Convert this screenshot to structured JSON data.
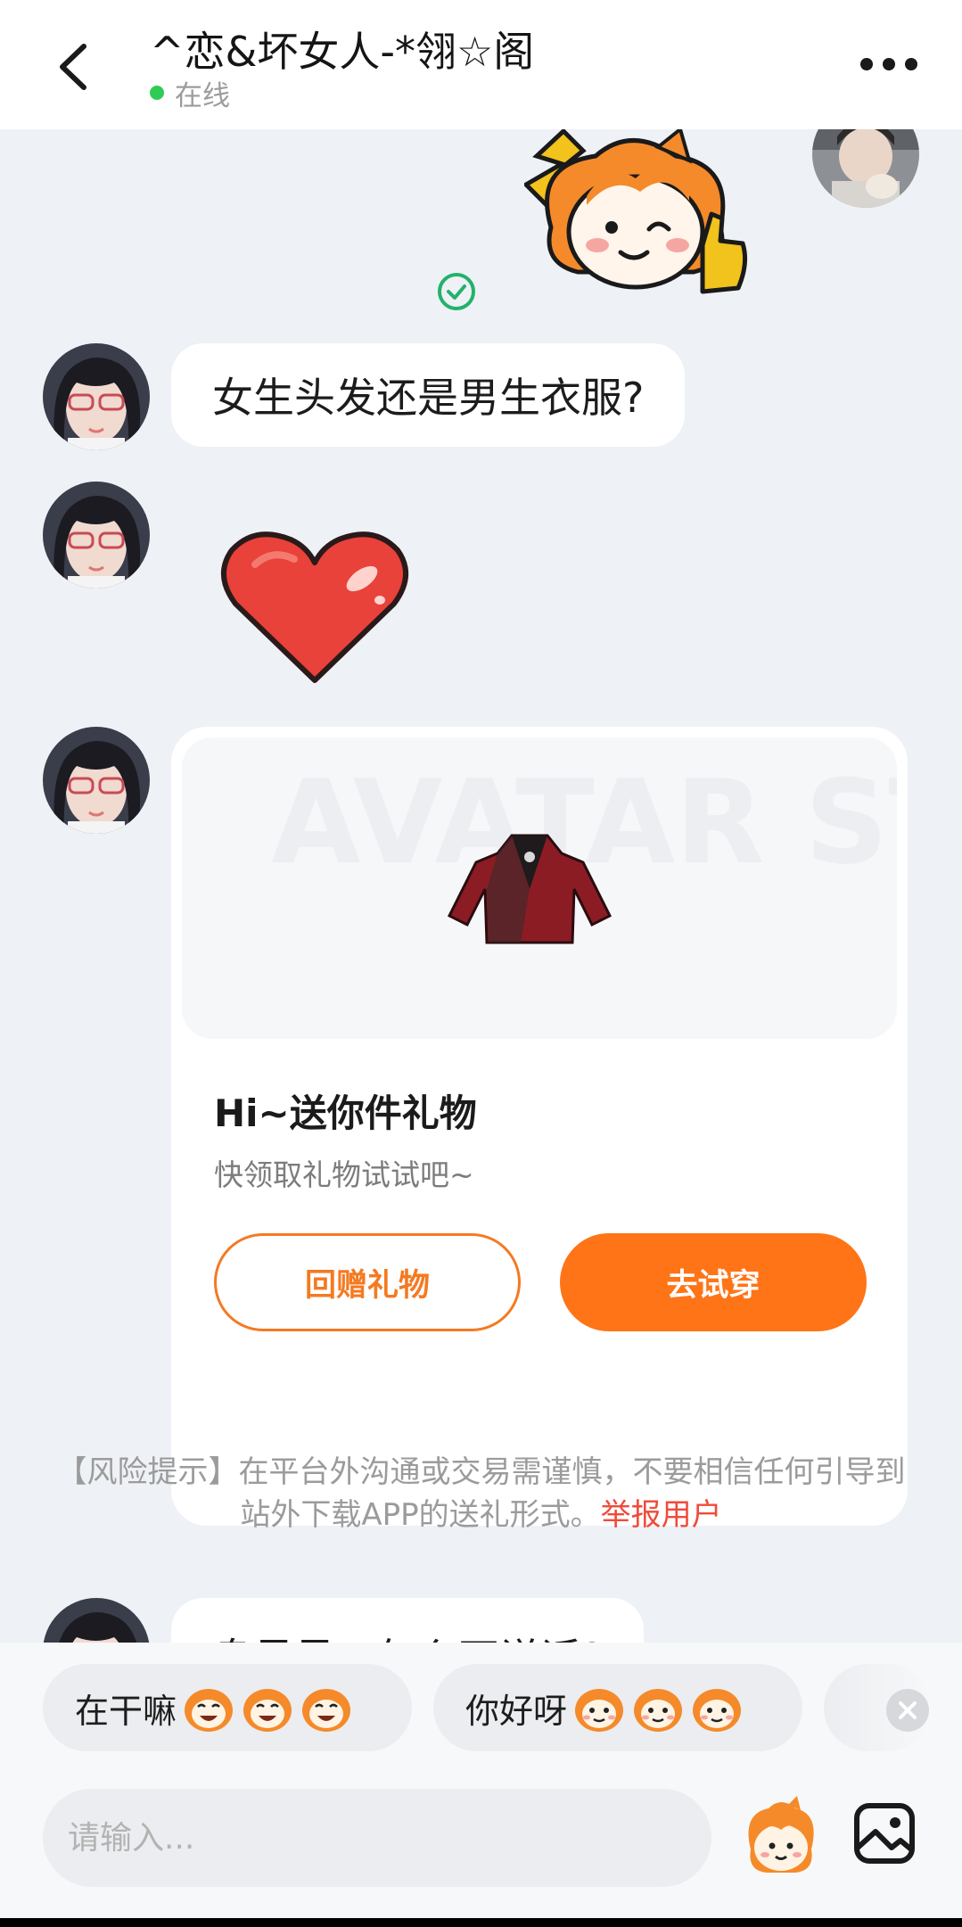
{
  "header": {
    "title": "^恋&坏女人-*翎☆阁",
    "status": "在线",
    "colors": {
      "online": "#2ecc55"
    }
  },
  "messages": [
    {
      "from": "me",
      "type": "sticker",
      "sticker": "orange-mascot-thumbs-up"
    },
    {
      "from": "other",
      "type": "text",
      "text": "女生头发还是男生衣服?"
    },
    {
      "from": "other",
      "type": "sticker",
      "sticker": "red-heart"
    },
    {
      "from": "other",
      "type": "gift-card",
      "title": "Hi~送你件礼物",
      "subtitle": "快领取礼物试试吧~",
      "image_watermark": "AVATAR STORE",
      "return_label": "回赠礼物",
      "try_label": "去试穿"
    },
    {
      "from": "other",
      "type": "text",
      "text": "息呆呆，怎么不说话?"
    }
  ],
  "risk_notice": {
    "text": "【风险提示】在平台外沟通或交易需谨慎，不要相信任何引导到站外下载APP的送礼形式。",
    "report_label": "举报用户"
  },
  "quick_replies": [
    {
      "label": "在干嘛",
      "emoji": "laughing-mascot"
    },
    {
      "label": "你好呀",
      "emoji": "smiling-mascot"
    }
  ],
  "composer": {
    "placeholder": "请输入..."
  },
  "icons": {
    "back": "chevron-left-icon",
    "more": "more-dots-icon",
    "read": "check-circle-icon",
    "emoji": "mascot-emoji-icon",
    "image": "image-icon",
    "close": "close-icon"
  },
  "theme": {
    "accent": "#ff7417",
    "danger": "#f04b3a",
    "check": "#23b26b"
  }
}
